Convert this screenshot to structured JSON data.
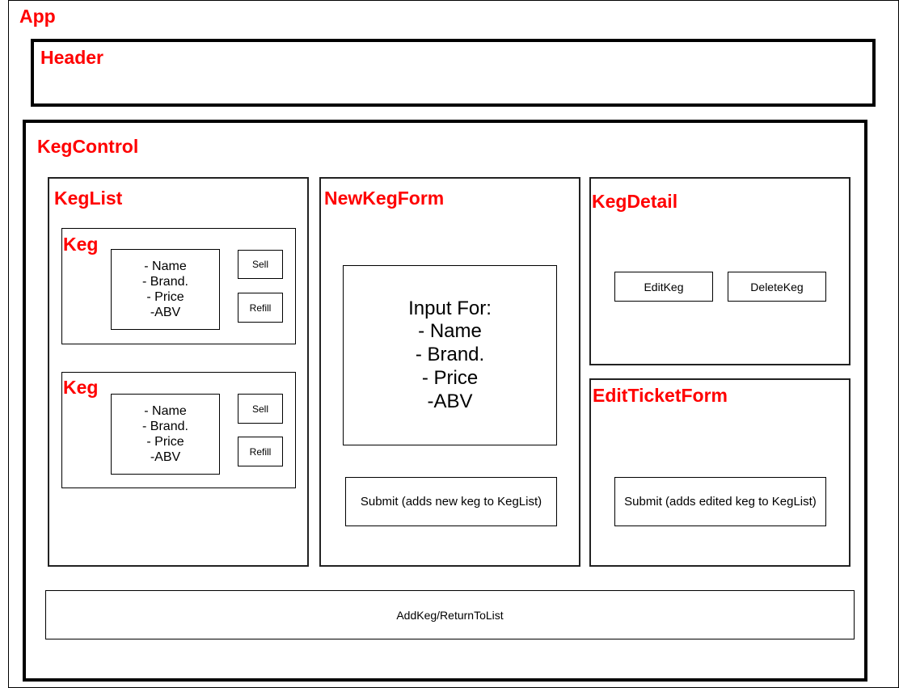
{
  "app": {
    "label": "App"
  },
  "header": {
    "label": "Header"
  },
  "keg_control": {
    "label": "KegControl",
    "keg_list": {
      "label": "KegList",
      "kegs": [
        {
          "label": "Keg",
          "fields": [
            "- Name",
            "- Brand.",
            "- Price",
            "-ABV"
          ],
          "sell": "Sell",
          "refill": "Refill"
        },
        {
          "label": "Keg",
          "fields": [
            "- Name",
            "- Brand.",
            "- Price",
            "-ABV"
          ],
          "sell": "Sell",
          "refill": "Refill"
        }
      ]
    },
    "new_keg_form": {
      "label": "NewKegForm",
      "input_lines": [
        "Input For:",
        "- Name",
        "- Brand.",
        "- Price",
        "-ABV"
      ],
      "submit": "Submit (adds new keg to KegList)"
    },
    "keg_detail": {
      "label": "KegDetail",
      "edit": "EditKeg",
      "delete": "DeleteKeg"
    },
    "edit_ticket_form": {
      "label": "EditTicketForm",
      "submit": "Submit (adds edited keg to KegList)"
    },
    "add_keg_button": "AddKeg/ReturnToList"
  },
  "colors": {
    "label": "#ff0000",
    "border": "#000000",
    "background": "#ffffff"
  }
}
